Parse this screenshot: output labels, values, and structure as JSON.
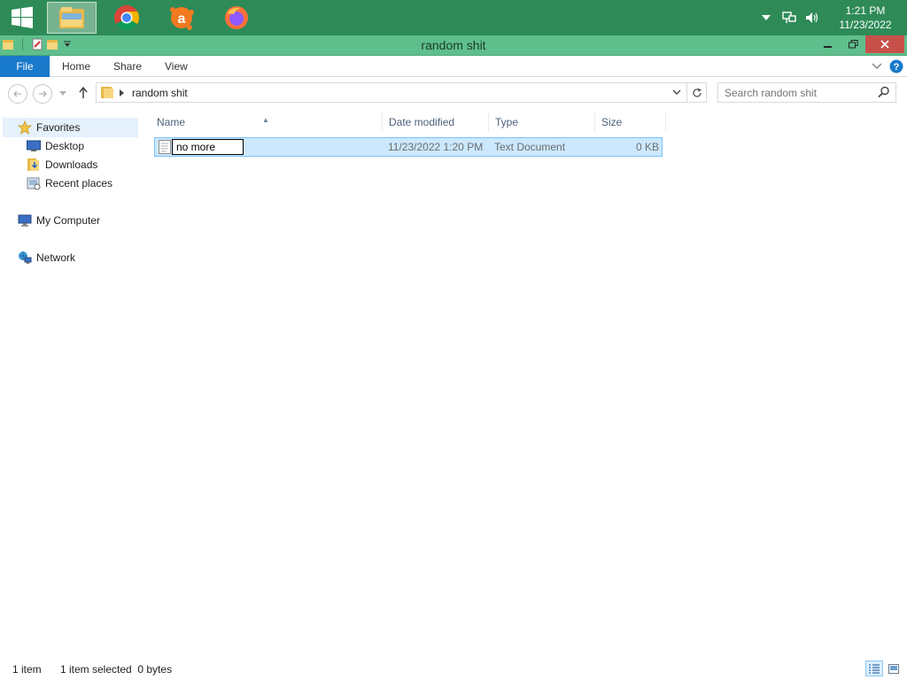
{
  "window": {
    "title": "random shit"
  },
  "taskbar": {
    "apps": [
      "start-button",
      "file-explorer",
      "chrome",
      "avast",
      "firefox"
    ],
    "clock": {
      "time": "1:21 PM",
      "date": "11/23/2022"
    }
  },
  "ribbon": {
    "tabs": [
      "File",
      "Home",
      "Share",
      "View"
    ]
  },
  "address": {
    "path": "random shit",
    "search_placeholder": "Search random shit"
  },
  "navigation": {
    "favorites": "Favorites",
    "items": [
      "Desktop",
      "Downloads",
      "Recent places"
    ],
    "computer": "My Computer",
    "network": "Network"
  },
  "columns": {
    "name": "Name",
    "date": "Date modified",
    "type": "Type",
    "size": "Size"
  },
  "files": [
    {
      "name": "no more",
      "date": "11/23/2022 1:20 PM",
      "type": "Text Document",
      "size": "0 KB"
    }
  ],
  "status": {
    "count": "1 item",
    "selected": "1 item selected  0 bytes"
  },
  "colors": {
    "taskbar": "#2e8b57",
    "titlebar": "#5fbf8c",
    "accent": "#1979ca",
    "selection": "#cce8ff",
    "close": "#c7504a"
  }
}
